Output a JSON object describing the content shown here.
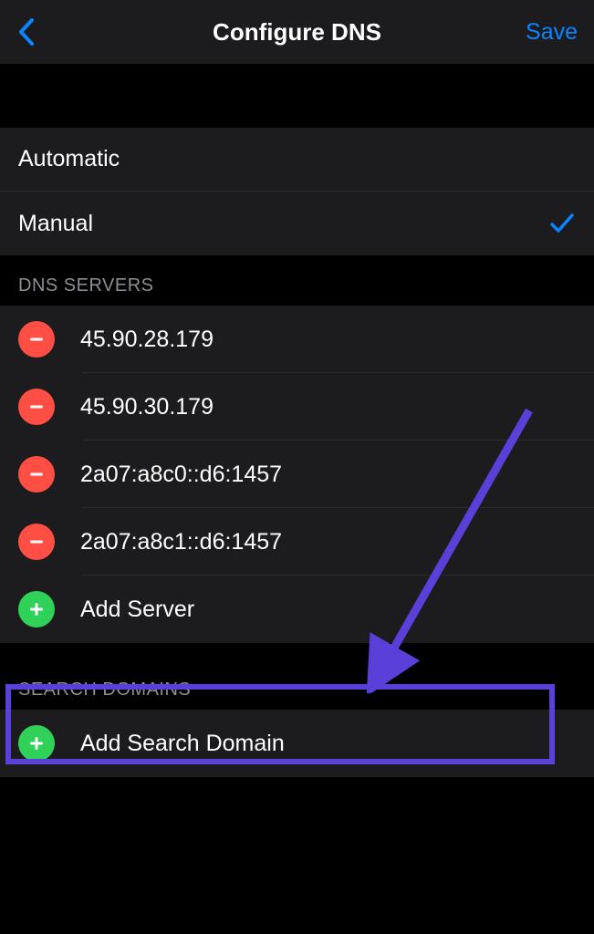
{
  "header": {
    "title": "Configure DNS",
    "save_label": "Save"
  },
  "modes": {
    "automatic_label": "Automatic",
    "manual_label": "Manual",
    "selected": "manual"
  },
  "dns_section": {
    "header": "DNS SERVERS",
    "servers": [
      "45.90.28.179",
      "45.90.30.179",
      "2a07:a8c0::d6:1457",
      "2a07:a8c1::d6:1457"
    ],
    "add_label": "Add Server"
  },
  "search_section": {
    "header": "SEARCH DOMAINS",
    "add_label": "Add Search Domain"
  },
  "colors": {
    "accent": "#0a84ff",
    "remove": "#ff4f44",
    "add": "#30d158",
    "annotation": "#5b3fd9"
  }
}
